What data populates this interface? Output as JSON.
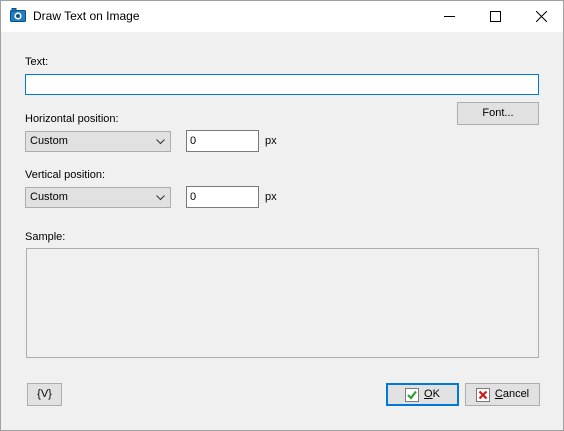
{
  "window": {
    "title": "Draw Text on Image",
    "icons": {
      "app": "image-app-icon",
      "minimize": "minimize-icon",
      "maximize": "maximize-icon",
      "close": "close-icon"
    }
  },
  "form": {
    "text_label": "Text:",
    "text_value": "",
    "font_button": "Font...",
    "horizontal": {
      "label": "Horizontal position:",
      "selected": "Custom",
      "value": "0",
      "unit": "px"
    },
    "vertical": {
      "label": "Vertical position:",
      "selected": "Custom",
      "value": "0",
      "unit": "px"
    },
    "sample_label": "Sample:"
  },
  "footer": {
    "vars_button": "{V}",
    "ok": {
      "accel": "O",
      "rest": "K"
    },
    "cancel": {
      "accel": "C",
      "rest": "ancel"
    }
  },
  "colors": {
    "accent": "#0078d7",
    "ok_check": "#2f9e2f",
    "cancel_x": "#d11a1a",
    "app_icon": "#1e7fc6"
  }
}
